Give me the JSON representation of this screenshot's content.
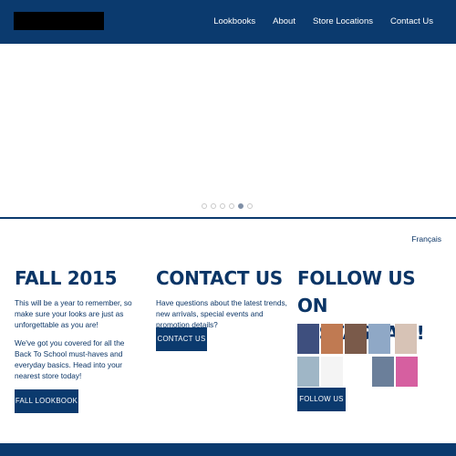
{
  "nav": {
    "items": [
      "Lookbooks",
      "About",
      "Store Locations",
      "Contact Us"
    ]
  },
  "hero": {
    "slides": 6,
    "active_slide": 5
  },
  "language_link": "Français",
  "fall": {
    "title": "FALL 2015",
    "para1": "This will be a year to remember, so make sure your looks are just as unforgettable as you are!",
    "para2": "We've got you covered for all the Back To School must-haves and everyday basics. Head into your nearest store today!",
    "button": "FALL LOOKBOOK"
  },
  "contact": {
    "title": "CONTACT US",
    "para": "Have questions about the latest trends, new arrivals, special events and promotion details?",
    "button": "CONTACT US"
  },
  "instagram": {
    "title_line1": "FOLLOW US ON",
    "title_line2": "INSTAGRAM!",
    "button": "FOLLOW US",
    "tile_colors": [
      "#3e4f7e",
      "#c07a52",
      "#7a5a4a",
      "#8fa8c6",
      "#d7c3b6",
      "#9fb6c6",
      "#f4f4f4",
      "#6b7f9a",
      "#d65fa0"
    ]
  },
  "colors": {
    "brand_navy": "#0b3a6e",
    "text_navy": "#0b3566"
  }
}
